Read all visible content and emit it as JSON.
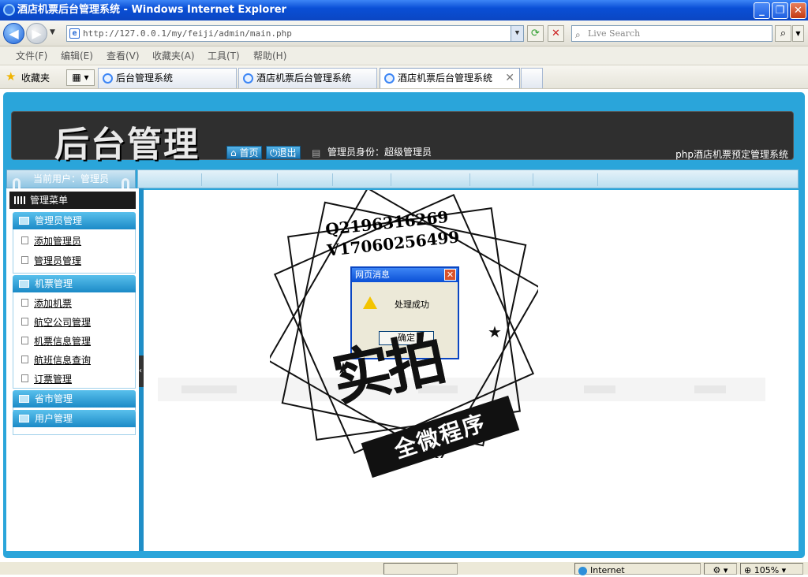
{
  "window": {
    "title": "酒店机票后台管理系统 - Windows Internet Explorer",
    "min_label": "_",
    "max_label": "❐",
    "close_label": "✕"
  },
  "nav": {
    "back_icon": "arrow-left-icon",
    "forward_icon": "arrow-right-icon",
    "address": "http://127.0.0.1/my/feiji/admin/main.php",
    "search_placeholder": "Live Search"
  },
  "menubar": [
    "文件(F)",
    "编辑(E)",
    "查看(V)",
    "收藏夹(A)",
    "工具(T)",
    "帮助(H)"
  ],
  "favorites": {
    "label": "收藏夹",
    "tabs": [
      {
        "label": "后台管理系统"
      },
      {
        "label": "酒店机票后台管理系统"
      },
      {
        "label": "酒店机票后台管理系统"
      }
    ],
    "tab_close": "✕"
  },
  "banner": {
    "logo": "后台管理",
    "home_label": "首页",
    "logout_label": "退出",
    "role": "管理员身份：超级管理员",
    "system_name": "php酒店机票预定管理系统"
  },
  "sidebar": {
    "current_user": "当前用户：管理员",
    "menu_title": "管理菜单",
    "groups": [
      {
        "label": "管理员管理",
        "items": [
          "添加管理员",
          "管理员管理"
        ]
      },
      {
        "label": "机票管理",
        "items": [
          "添加机票",
          "航空公司管理",
          "机票信息管理",
          "航班信息查询",
          "订票管理"
        ]
      },
      {
        "label": "省市管理",
        "items": []
      },
      {
        "label": "用户管理",
        "items": []
      }
    ]
  },
  "dialog": {
    "title": "网页消息",
    "message": "处理成功",
    "ok_label": "确定"
  },
  "watermark": {
    "qq": "Q2196316269",
    "v": "V17060256499",
    "big": "实拍",
    "ribbon": "全微程序"
  },
  "status": {
    "zone": "Internet",
    "zoom": "105%"
  }
}
